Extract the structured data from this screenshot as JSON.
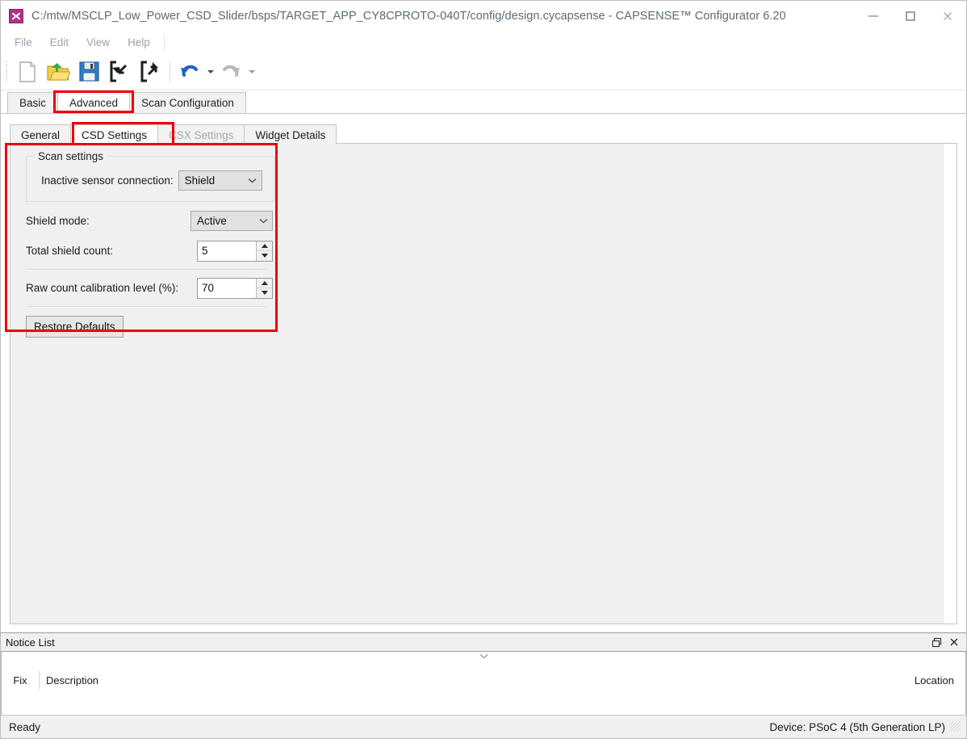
{
  "window": {
    "title": "C:/mtw/MSCLP_Low_Power_CSD_Slider/bsps/TARGET_APP_CY8CPROTO-040T/config/design.cycapsense - CAPSENSE™ Configurator 6.20",
    "icon": "capsense-app-icon",
    "controls": {
      "minimize": "minimize-icon",
      "maximize": "maximize-icon",
      "close": "close-icon"
    }
  },
  "menu": {
    "items": [
      {
        "label": "File"
      },
      {
        "label": "Edit"
      },
      {
        "label": "View"
      },
      {
        "label": "Help"
      }
    ]
  },
  "toolbar": {
    "buttons": [
      {
        "name": "new-file-icon",
        "tooltip": "New"
      },
      {
        "name": "open-folder-icon",
        "tooltip": "Open"
      },
      {
        "name": "save-icon",
        "tooltip": "Save"
      },
      {
        "name": "import-icon",
        "tooltip": "Import"
      },
      {
        "name": "export-icon",
        "tooltip": "Export"
      },
      {
        "name": "undo-icon",
        "tooltip": "Undo"
      },
      {
        "name": "redo-icon",
        "tooltip": "Redo"
      }
    ]
  },
  "outer_tabs": {
    "items": [
      {
        "label": "Basic",
        "active": false
      },
      {
        "label": "Advanced",
        "active": true
      },
      {
        "label": "Scan Configuration",
        "active": false
      }
    ]
  },
  "inner_tabs": {
    "items": [
      {
        "label": "General",
        "active": false,
        "disabled": false
      },
      {
        "label": "CSD Settings",
        "active": true,
        "disabled": false
      },
      {
        "label": "CSX Settings",
        "active": false,
        "disabled": true
      },
      {
        "label": "Widget Details",
        "active": false,
        "disabled": false
      }
    ]
  },
  "csd_settings": {
    "group_title": "Scan settings",
    "inactive_sensor_connection": {
      "label": "Inactive sensor connection:",
      "value": "Shield"
    },
    "shield_mode": {
      "label": "Shield mode:",
      "value": "Active"
    },
    "total_shield_count": {
      "label": "Total shield count:",
      "value": "5"
    },
    "raw_count_calibration_level": {
      "label": "Raw count calibration level (%):",
      "value": "70"
    },
    "restore_defaults_label": "Restore Defaults"
  },
  "notice_list": {
    "title": "Notice List",
    "float_icon": "float-window-icon",
    "close_icon": "close-icon",
    "collapse_icon": "chevron-down-icon",
    "columns": [
      "Fix",
      "Description",
      "Location"
    ],
    "rows": []
  },
  "status_bar": {
    "left": "Ready",
    "right": "Device: PSoC 4 (5th Generation LP)"
  },
  "highlights": {
    "accent_color": "#ef0000",
    "regions": [
      {
        "name": "advanced-tab-highlight"
      },
      {
        "name": "csd-settings-tab-highlight"
      },
      {
        "name": "scan-settings-panel-highlight"
      }
    ]
  }
}
